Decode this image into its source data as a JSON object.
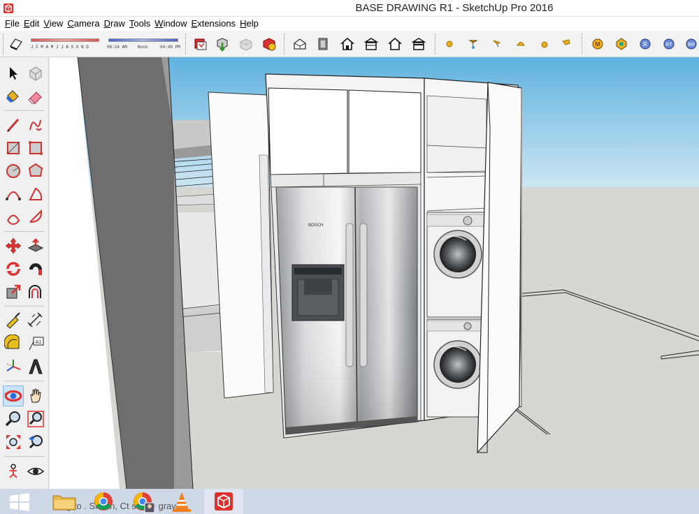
{
  "window": {
    "title": "BASE DRAWING R1 - SketchUp Pro 2016",
    "icon": "sketchup-logo-icon"
  },
  "menu": [
    "File",
    "Edit",
    "View",
    "Camera",
    "Draw",
    "Tools",
    "Window",
    "Extensions",
    "Help"
  ],
  "shadows": {
    "months": "J F M A M J J A S O N D",
    "time_start": "06:24 AM",
    "time_noon": "Noon",
    "time_end": "04:49 PM"
  },
  "toolbar_icons": [
    "display-shadows-icon",
    "add-location-icon",
    "get-models-icon",
    "share-model-icon",
    "extension-warehouse-icon",
    "iso-view-icon",
    "top-view-icon",
    "front-view-icon",
    "right-view-icon",
    "back-view-icon",
    "left-view-icon",
    "section-plane-icon",
    "light-bulb-icon",
    "spotlight-icon",
    "light-icon",
    "dome-light-icon",
    "sun-icon",
    "material-icon",
    "render-icon",
    "render-region-icon",
    "batch-render-icon"
  ],
  "palette_icons": [
    "select-icon",
    "make-component-icon",
    "paint-bucket-icon",
    "eraser-icon",
    "line-icon",
    "freehand-icon",
    "rectangle-icon",
    "rotated-rectangle-icon",
    "circle-icon",
    "polygon-icon",
    "arc-icon",
    "pie-icon",
    "two-point-arc-icon",
    "three-point-arc-icon",
    "move-icon",
    "push-pull-icon",
    "rotate-icon",
    "follow-me-icon",
    "scale-icon",
    "offset-icon",
    "tape-measure-icon",
    "dimension-icon",
    "protractor-icon",
    "text-icon",
    "axes-icon",
    "3d-text-icon",
    "orbit-icon",
    "pan-icon",
    "zoom-icon",
    "zoom-window-icon",
    "zoom-extents-icon",
    "previous-view-icon",
    "position-camera-icon",
    "look-around-icon"
  ],
  "viewport": {
    "fridge_brand": "BOSCH"
  },
  "status": {
    "text": "g to    . Shi     an, Ct     suspe    gravity."
  },
  "taskbar": [
    "windows-start-icon",
    "file-explorer-icon",
    "chrome-icon",
    "chrome-profile-icon",
    "vlc-icon",
    "sketchup-icon"
  ]
}
